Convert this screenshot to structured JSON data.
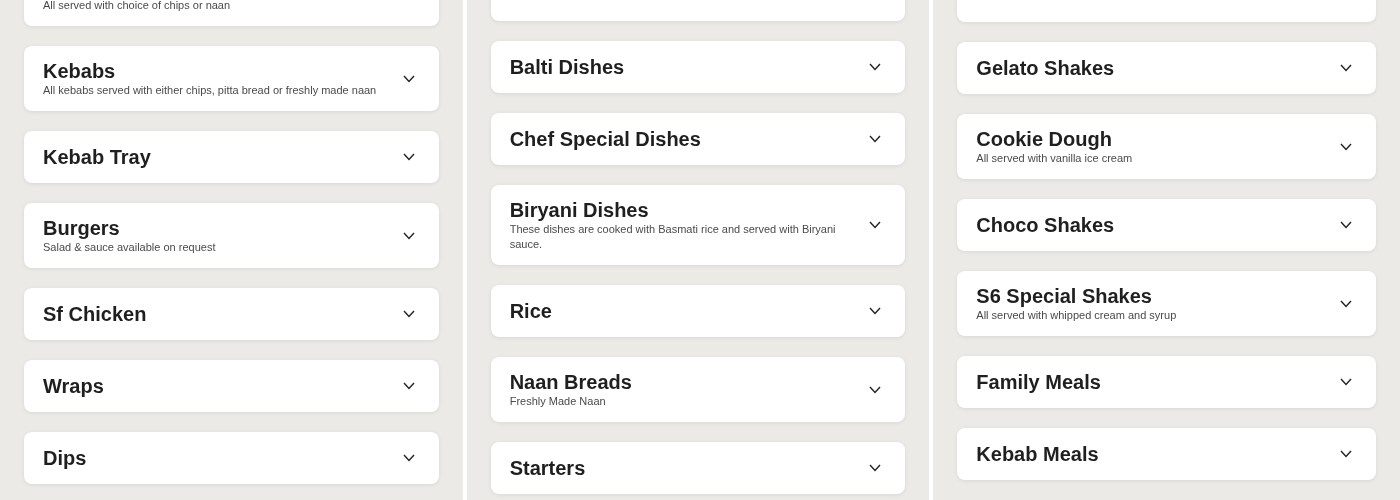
{
  "columns": [
    {
      "sections": [
        {
          "description": "All served with choice of chips or naan"
        },
        {
          "title": "Kebabs",
          "description": "All kebabs served with either chips, pitta bread or freshly made naan",
          "expanded": false
        },
        {
          "title": "Kebab Tray",
          "expanded": false
        },
        {
          "title": "Burgers",
          "description": "Salad & sauce available on request",
          "expanded": false
        },
        {
          "title": "Sf Chicken",
          "expanded": false
        },
        {
          "title": "Wraps",
          "expanded": false
        },
        {
          "title": "Dips",
          "expanded": false
        }
      ]
    },
    {
      "sections": [
        {
          "title": "Balti Dishes",
          "expanded": false
        },
        {
          "title": "Chef Special Dishes",
          "expanded": false
        },
        {
          "title": "Biryani Dishes",
          "description": "These dishes are cooked with Basmati rice and served with Biryani sauce.",
          "expanded": false
        },
        {
          "title": "Rice",
          "expanded": false
        },
        {
          "title": "Naan Breads",
          "description": "Freshly Made Naan",
          "expanded": false
        },
        {
          "title": "Starters",
          "expanded": false
        }
      ]
    },
    {
      "sections": [
        {
          "title": "Gelato Shakes",
          "expanded": false
        },
        {
          "title": "Cookie Dough",
          "description": "All served with vanilla ice cream",
          "expanded": false
        },
        {
          "title": "Choco Shakes",
          "expanded": false
        },
        {
          "title": "S6 Special Shakes",
          "description": "All served with whipped cream and syrup",
          "expanded": false
        },
        {
          "title": "Family Meals",
          "expanded": false
        },
        {
          "title": "Kebab Meals",
          "expanded": false
        }
      ]
    }
  ]
}
